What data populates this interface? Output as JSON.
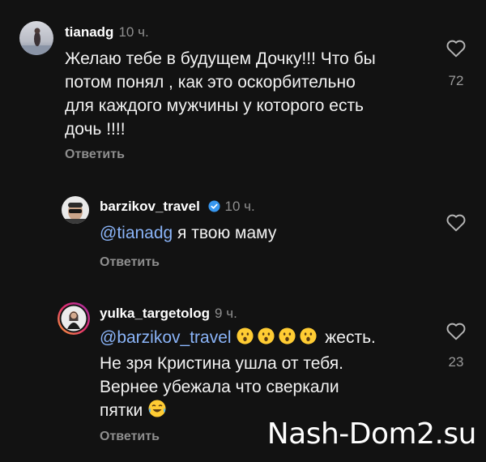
{
  "comments": [
    {
      "username": "tianadg",
      "time": "10 ч.",
      "text_lines": [
        "Желаю тебе в будущем Дочку!!! Что бы",
        "потом понял , как это оскорбительно",
        "для каждого мужчины у которого есть",
        "дочь !!!!"
      ],
      "reply_label": "Ответить",
      "likes": "72",
      "like_icon": "heart-outline-icon"
    },
    {
      "username": "barzikov_travel",
      "time": "10 ч.",
      "verified": true,
      "mention": "@tianadg",
      "text": " я твою маму",
      "reply_label": "Ответить",
      "like_icon": "heart-outline-icon"
    },
    {
      "username": "yulka_targetolog",
      "time": "9 ч.",
      "mention": "@barzikov_travel",
      "line1_tail": " жесть.",
      "emoji_line1": [
        "hushed-face-emoji",
        "hushed-face-emoji",
        "hushed-face-emoji",
        "hushed-face-emoji"
      ],
      "text_lines": [
        "Не зря Кристина ушла от тебя.",
        "Вернее убежала что сверкали",
        "пятки "
      ],
      "emoji_end": "tears-of-joy-emoji",
      "reply_label": "Ответить",
      "likes": "23",
      "like_icon": "heart-outline-icon"
    }
  ],
  "watermark": "Nash-Dom2.su",
  "colors": {
    "background": "#121212",
    "mention": "#8ab4f8",
    "verified": "#3797f0",
    "muted": "#8e8e8e"
  }
}
